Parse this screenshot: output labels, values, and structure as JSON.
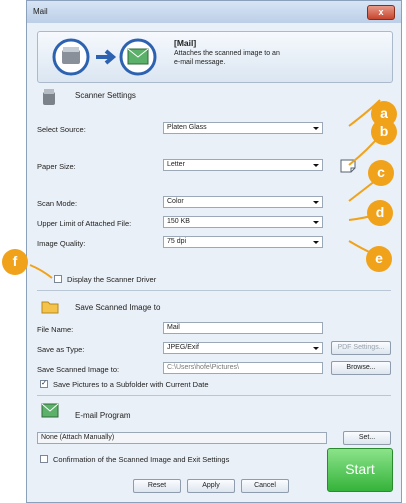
{
  "window": {
    "title": "Mail",
    "close_glyph": "x"
  },
  "header": {
    "title": "[Mail]",
    "description": "Attaches the scanned image to an e-mail message."
  },
  "scanner": {
    "heading": "Scanner Settings",
    "source_label": "Select Source:",
    "source_value": "Platen Glass",
    "paper_label": "Paper Size:",
    "paper_value": "Letter",
    "scan_mode_label": "Scan Mode:",
    "scan_mode_value": "Color",
    "upper_limit_label": "Upper Limit of Attached File:",
    "upper_limit_value": "150 KB",
    "quality_label": "Image Quality:",
    "quality_value": "75 dpi",
    "driver_checkbox_label": "Display the Scanner Driver"
  },
  "save": {
    "heading": "Save Scanned Image to",
    "file_name_label": "File Name:",
    "file_name_value": "Mail",
    "type_label": "Save as Type:",
    "type_value": "JPEG/Exif",
    "pdf_button": "PDF Settings...",
    "path_label": "Save Scanned Image to:",
    "path_value": "C:\\Users\\hofe\\Pictures\\",
    "browse_button": "Browse...",
    "subfolder_label": "Save Pictures to a Subfolder with Current Date",
    "subfolder_checked": "✓"
  },
  "email": {
    "heading": "E-mail Program",
    "program_value": "None (Attach Manually)",
    "set_button": "Set..."
  },
  "footer": {
    "confirm_label": "Confirmation of the Scanned Image and Exit Settings",
    "reset_button": "Reset",
    "apply_button": "Apply",
    "cancel_button": "Cancel",
    "start_button": "Start"
  },
  "callouts": [
    "a",
    "b",
    "c",
    "d",
    "e",
    "f"
  ],
  "colors": {
    "callout": "#f0a21a",
    "start": "#35b33a"
  }
}
